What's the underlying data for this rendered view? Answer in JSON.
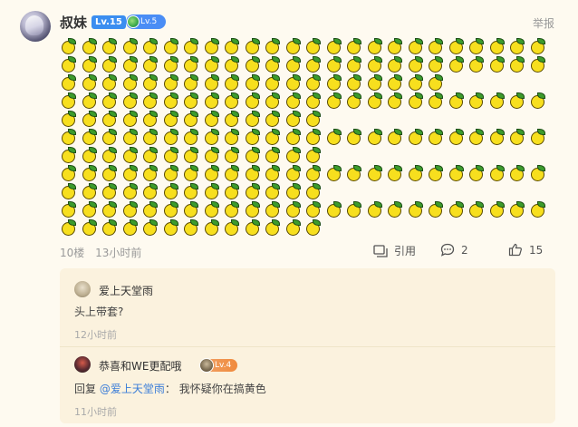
{
  "post": {
    "username": "叔妹",
    "level_badge": "Lv.15",
    "secondary_level": "Lv.5",
    "report_label": "举报",
    "lemon_rows": [
      24,
      24,
      19,
      24,
      13,
      24,
      13,
      24,
      13,
      24,
      13
    ],
    "floor": "10楼",
    "time": "13小时前",
    "quote_label": "引用",
    "comment_count": "2",
    "like_count": "15"
  },
  "replies": [
    {
      "username": "爱上天堂雨",
      "text": "头上带套?",
      "time": "12小时前"
    },
    {
      "username": "恭喜和WE更配哦",
      "level": "Lv.4",
      "reply_prefix": "回复",
      "mention": "@爱上天堂雨",
      "separator": "：",
      "text": "我怀疑你在搞黄色",
      "time": "11小时前"
    }
  ],
  "colors": {
    "background": "#fefaf0",
    "reply_background": "#fbf2de",
    "badge_blue": "#3b8ef0",
    "mention_blue": "#3b7dd8",
    "lemon_yellow": "#f7df1e",
    "leaf_green": "#3c9b2c"
  },
  "icons": [
    "lemon-emoji-icon",
    "quote-icon",
    "comment-icon",
    "thumbs-up-icon"
  ]
}
